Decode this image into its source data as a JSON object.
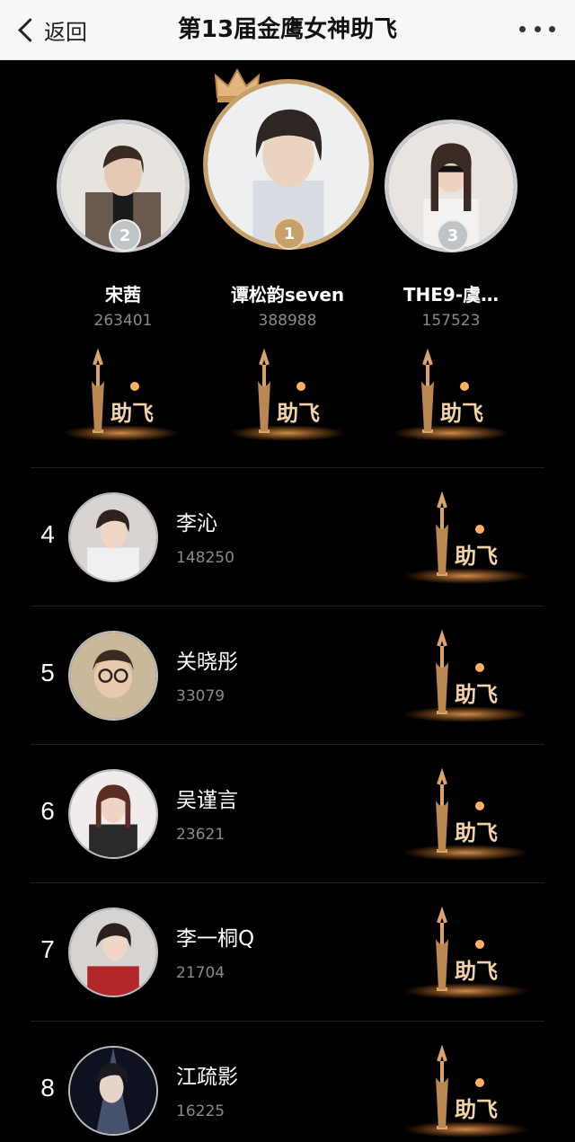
{
  "nav": {
    "back_label": "返回",
    "title": "第13届金鹰女神助飞",
    "more_icon": "more-dots-icon",
    "back_icon": "chevron-left-icon"
  },
  "boost_label": "助飞",
  "podium": [
    {
      "rank": "2",
      "name": "宋茜",
      "score": "263401",
      "medal_color": "#bfc4c9"
    },
    {
      "rank": "1",
      "name": "谭松韵seven",
      "score": "388988",
      "medal_color": "#c8a06a"
    },
    {
      "rank": "3",
      "name": "THE9-虞…",
      "score": "157523",
      "medal_color": "#bfc4c9"
    }
  ],
  "list": [
    {
      "rank": "4",
      "name": "李沁",
      "score": "148250"
    },
    {
      "rank": "5",
      "name": "关晓彤",
      "score": "33079"
    },
    {
      "rank": "6",
      "name": "吴谨言",
      "score": "23621"
    },
    {
      "rank": "7",
      "name": "李一桐Q",
      "score": "21704"
    },
    {
      "rank": "8",
      "name": "江疏影",
      "score": "16225"
    }
  ]
}
